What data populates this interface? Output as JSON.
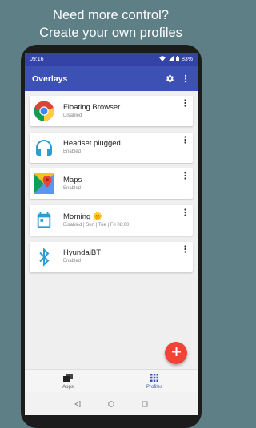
{
  "headline": [
    "Need more control?",
    "Create your own profiles"
  ],
  "status": {
    "time": "09:16",
    "battery": "83%"
  },
  "appbar": {
    "title": "Overlays",
    "settings_icon": "gear-icon",
    "menu_icon": "more-vert-icon"
  },
  "profiles": [
    {
      "name": "Floating Browser",
      "status": "Disabled",
      "icon": "chrome-icon"
    },
    {
      "name": "Headset plugged",
      "status": "Enabled",
      "icon": "headset-icon"
    },
    {
      "name": "Maps",
      "status": "Enabled",
      "icon": "maps-icon"
    },
    {
      "name": "Morning 🌞",
      "status": "Disabled | Sun | Tue | Fri 08:00",
      "icon": "calendar-icon"
    },
    {
      "name": "HyundaiBT",
      "status": "Enabled",
      "icon": "bluetooth-icon"
    }
  ],
  "fab": {
    "icon": "plus-icon"
  },
  "bottom_nav": [
    {
      "label": "Apps",
      "icon": "apps-stack-icon",
      "active": false
    },
    {
      "label": "Profiles",
      "icon": "grid-icon",
      "active": true
    }
  ],
  "colors": {
    "primary": "#3d51b5",
    "statusbar": "#3343a6",
    "accent": "#f44336",
    "background": "#5f7f86"
  }
}
